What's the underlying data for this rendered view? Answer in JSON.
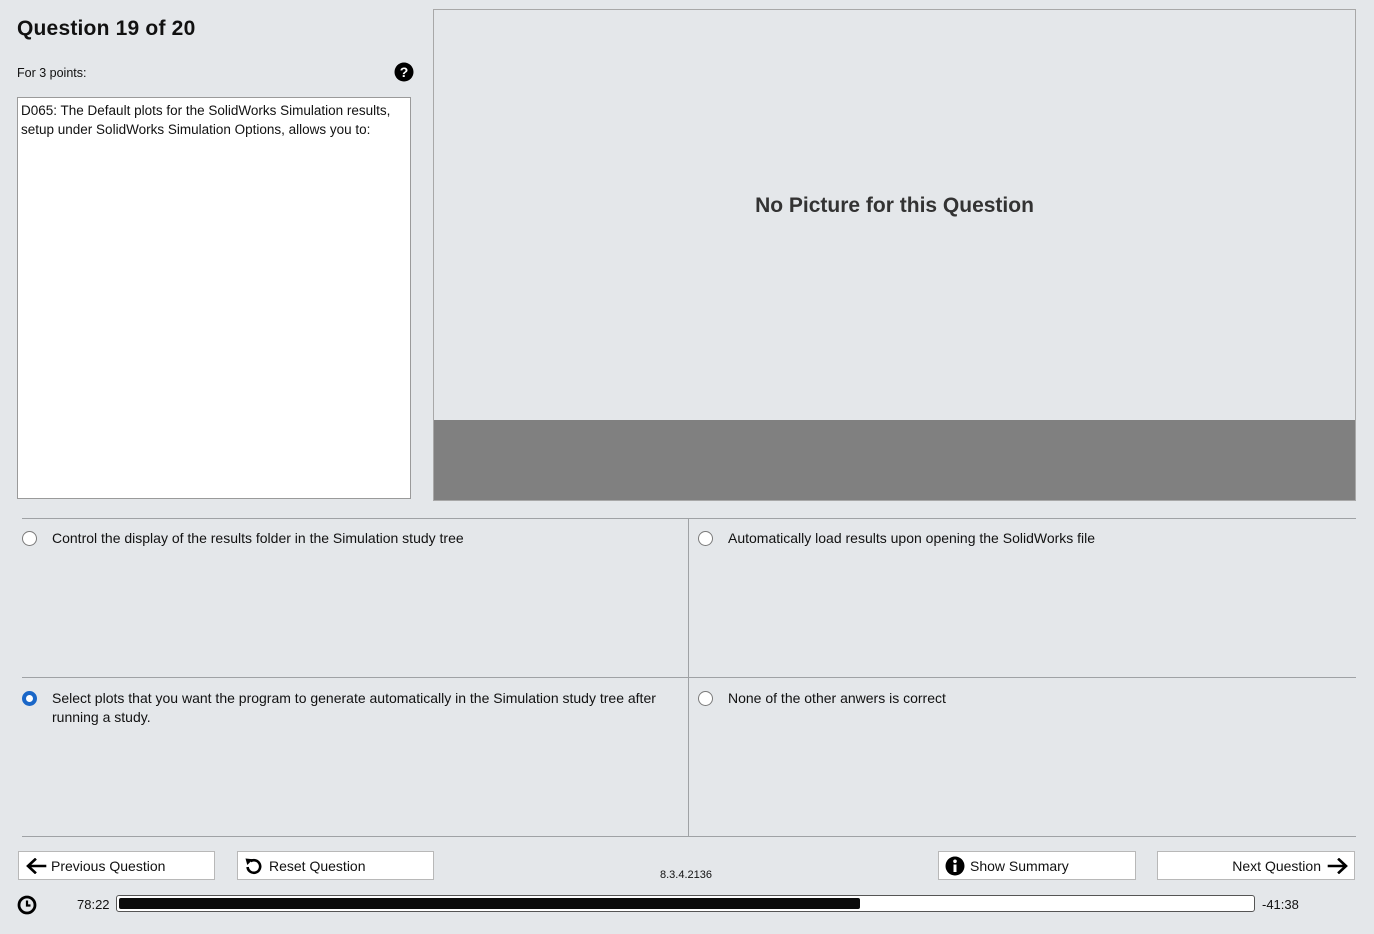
{
  "header": {
    "title": "Question 19 of 20",
    "points_label": "For 3 points:"
  },
  "question": {
    "text": "D065: The Default plots for the SolidWorks Simulation results, setup under SolidWorks Simulation Options, allows you to:"
  },
  "picture": {
    "placeholder": "No Picture for this Question"
  },
  "answers": [
    {
      "label": "Control the display of the results folder in the Simulation study tree",
      "selected": false
    },
    {
      "label": "Automatically load results upon opening the SolidWorks file",
      "selected": false
    },
    {
      "label": "Select plots that you want the program to generate automatically in the Simulation study tree after running a study.",
      "selected": true
    },
    {
      "label": "None of the other anwers is correct",
      "selected": false
    }
  ],
  "footer": {
    "previous_label": "Previous Question",
    "reset_label": "Reset Question",
    "version": "8.3.4.2136",
    "summary_label": "Show Summary",
    "next_label": "Next Question"
  },
  "timer": {
    "elapsed": "78:22",
    "remaining": "-41:38",
    "progress_fraction": 0.654
  },
  "icons": {
    "help": "help-icon",
    "clock": "clock-icon",
    "arrow_left": "arrow-left-icon",
    "reset": "reset-icon",
    "info": "info-icon",
    "arrow_right": "arrow-right-icon"
  },
  "colors": {
    "background": "#e4e7ea",
    "radio_selected": "#1a67c8",
    "picture_strip": "#808080",
    "progress_fill": "#0b0b0b"
  }
}
